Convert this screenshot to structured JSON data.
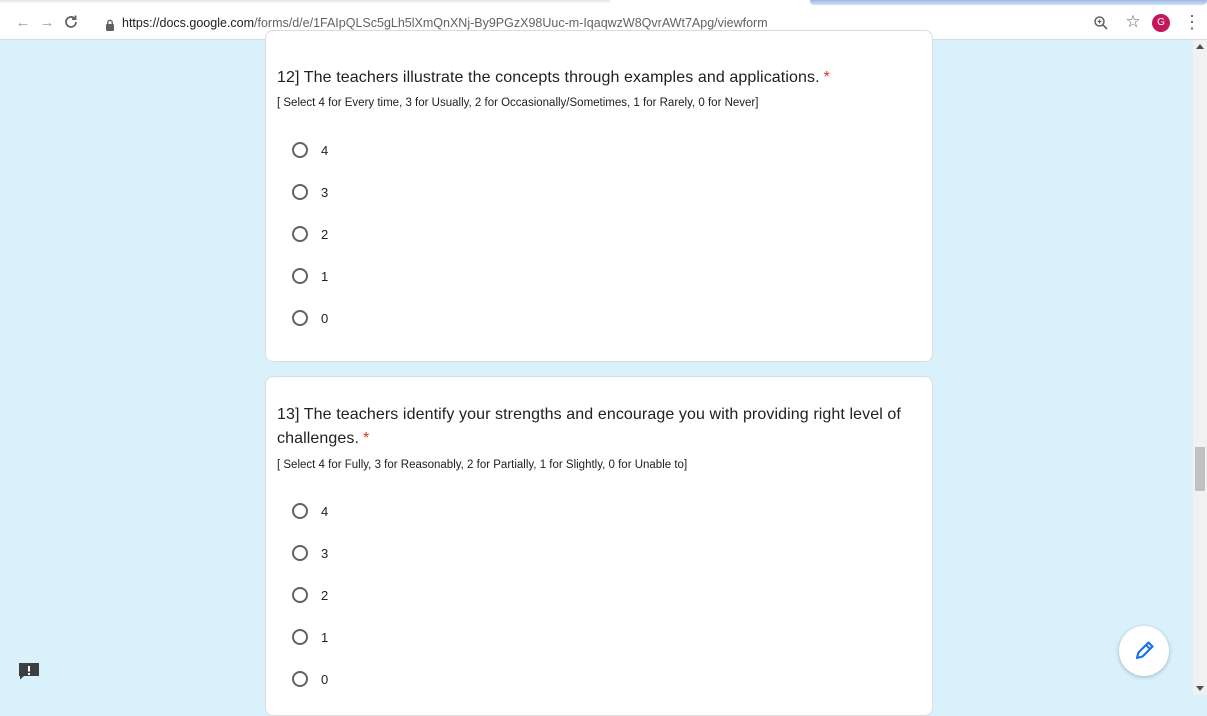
{
  "browser": {
    "url_host": "https://docs.google.com",
    "url_path": "/forms/d/e/1FAIpQLSc5gLh5lXmQnXNj-By9PGzX98Uuc-m-IqaqwzW8QvrAWt7Apg/viewform",
    "avatar_letter": "G",
    "icons": {
      "back": "arrow-left-icon",
      "forward": "arrow-right-icon",
      "reload": "reload-icon",
      "lock": "lock-icon",
      "zoom": "zoom-icon",
      "bookmark": "star-icon",
      "menu": "kebab-menu-icon"
    },
    "avatar_color": "#c2185b"
  },
  "form": {
    "required_marker": "*",
    "questions": [
      {
        "title": "12] The teachers illustrate the concepts through examples and applications.",
        "hint": "[ Select 4 for Every time, 3 for Usually, 2 for Occasionally/Sometimes, 1 for Rarely, 0 for Never]",
        "options": [
          "4",
          "3",
          "2",
          "1",
          "0"
        ]
      },
      {
        "title": "13] The teachers identify your strengths and encourage you with providing right level of challenges.",
        "hint": "[ Select 4 for Fully, 3 for Reasonably, 2 for Partially, 1 for Slightly, 0 for Unable to]",
        "options": [
          "4",
          "3",
          "2",
          "1",
          "0"
        ]
      }
    ]
  },
  "actions": {
    "edit_icon": "pencil-icon",
    "edit_color": "#1a73e8",
    "feedback_icon": "report-feedback-icon"
  },
  "colors": {
    "page_background": "#d9f1fb",
    "required": "#d93025"
  }
}
